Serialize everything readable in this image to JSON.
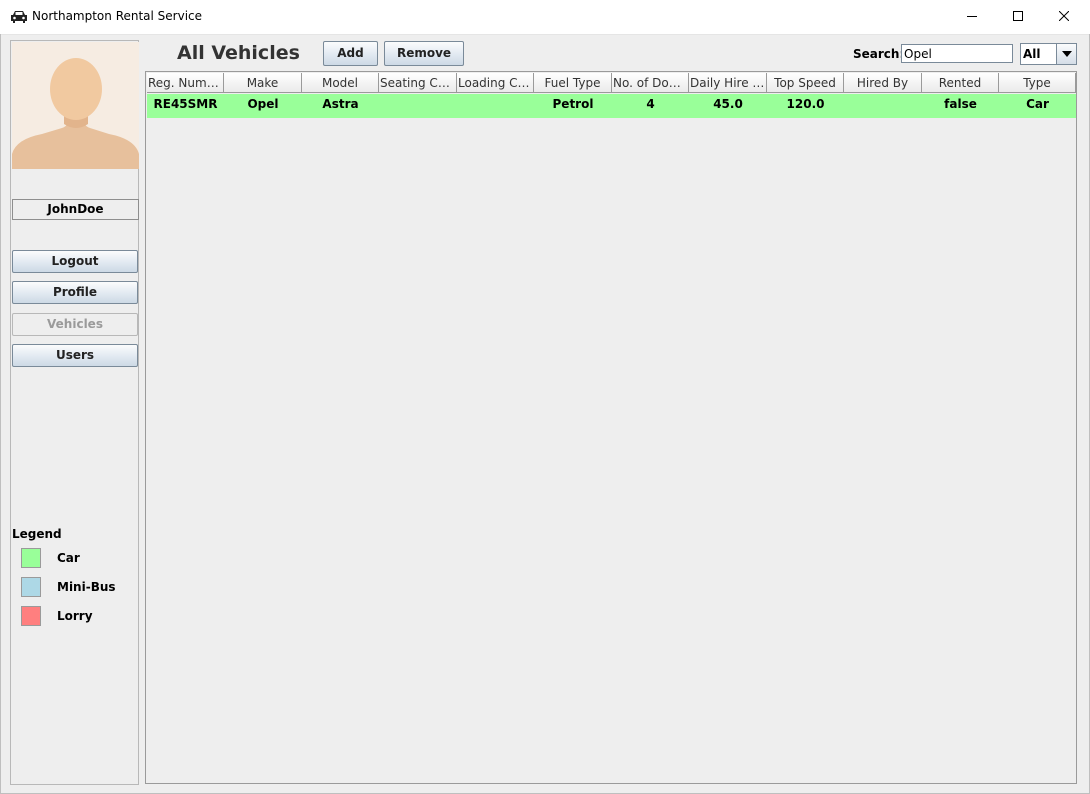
{
  "window": {
    "title": "Northampton Rental Service"
  },
  "sidebar": {
    "username": "JohnDoe",
    "nav": [
      {
        "label": "Logout",
        "enabled": true
      },
      {
        "label": "Profile",
        "enabled": true
      },
      {
        "label": "Vehicles",
        "enabled": false
      },
      {
        "label": "Users",
        "enabled": true
      }
    ],
    "legend": {
      "title": "Legend",
      "items": [
        {
          "label": "Car",
          "color": "#99ff99"
        },
        {
          "label": "Mini-Bus",
          "color": "#add8e6"
        },
        {
          "label": "Lorry",
          "color": "#ff7f7f"
        }
      ]
    }
  },
  "main": {
    "title": "All Vehicles",
    "add_label": "Add",
    "remove_label": "Remove",
    "search_label": "Search:",
    "search_value": "Opel",
    "type_filter": "All"
  },
  "table": {
    "columns": [
      "Reg. Number",
      "Make",
      "Model",
      "Seating Ca...",
      "Loading Ca...",
      "Fuel Type",
      "No. of Doors",
      "Daily Hire R...",
      "Top Speed",
      "Hired By",
      "Rented",
      "Type"
    ],
    "rows": [
      [
        "RE45SMR",
        "Opel",
        "Astra",
        "",
        "",
        "Petrol",
        "4",
        "45.0",
        "120.0",
        "",
        "false",
        "Car"
      ]
    ],
    "row_color": "#99ff99"
  }
}
